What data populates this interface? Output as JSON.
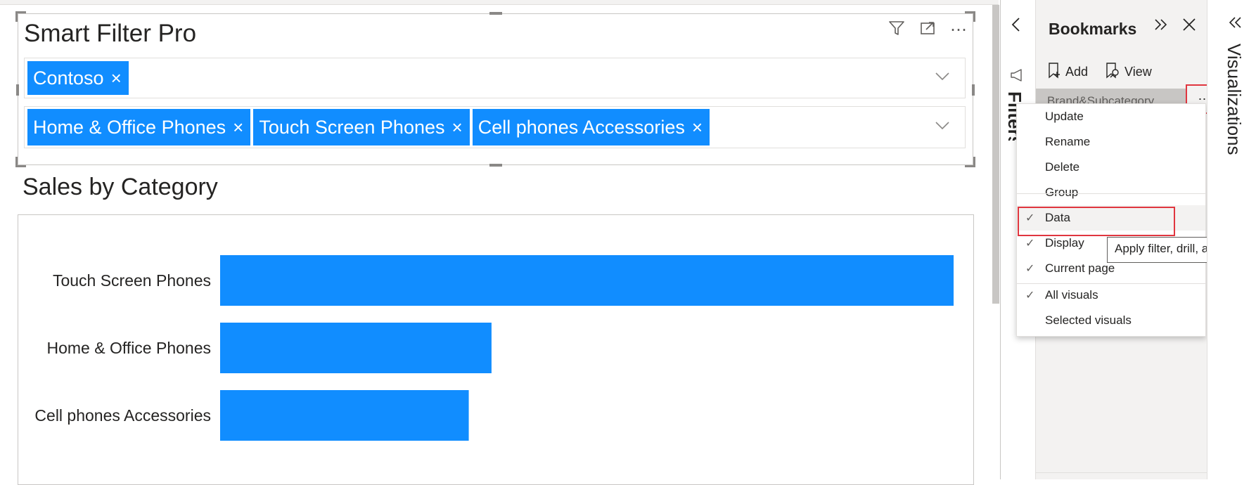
{
  "smart_filter": {
    "title": "Smart Filter Pro",
    "row1_chips": [
      "Contoso"
    ],
    "row2_chips": [
      "Home & Office Phones",
      "Touch Screen Phones",
      "Cell phones Accessories"
    ],
    "chip_close_glyph": "×",
    "more_options_glyph": "⋯"
  },
  "chart": {
    "title": "Sales by Category",
    "bar_color": "#118dff"
  },
  "chart_data": {
    "type": "bar",
    "orientation": "horizontal",
    "categories": [
      "Touch Screen Phones",
      "Home & Office Phones",
      "Cell phones Accessories"
    ],
    "values": [
      1.0,
      0.37,
      0.339
    ],
    "xlim": [
      0,
      1.0
    ],
    "grid": false,
    "legend": "none"
  },
  "filters_pane": {
    "label": "Filters",
    "collapse_glyph": "‹"
  },
  "bookmarks": {
    "title": "Bookmarks",
    "add_label": "Add",
    "view_label": "View",
    "selected_bookmark": "Brand&Subcategory",
    "more_glyph": "⋯"
  },
  "context_menu": {
    "items": [
      {
        "label": "Update",
        "checked": false
      },
      {
        "label": "Rename",
        "checked": false
      },
      {
        "label": "Delete",
        "checked": false
      },
      {
        "label": "Group",
        "checked": false
      },
      {
        "label": "Data",
        "checked": true
      },
      {
        "label": "Display",
        "checked": true
      },
      {
        "label": "Current page",
        "checked": true
      },
      {
        "label": "All visuals",
        "checked": true
      },
      {
        "label": "Selected visuals",
        "checked": false
      }
    ],
    "check_glyph": "✓"
  },
  "tooltip": {
    "text": "Apply filter, drill, and sort"
  },
  "visualizations_pane": {
    "label": "Visualizations",
    "expand_glyph": "«"
  },
  "colors": {
    "accent": "#118dff",
    "highlight_border": "#e0363f",
    "pane_bg": "#f3f2f1"
  }
}
